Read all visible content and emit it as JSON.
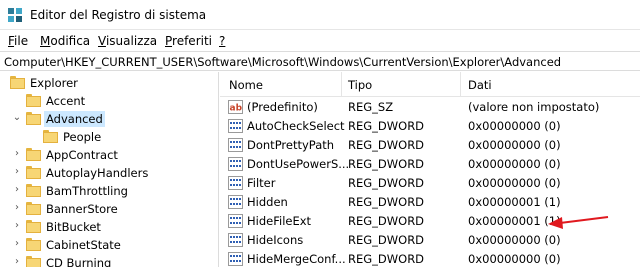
{
  "window": {
    "title": "Editor del Registro di sistema"
  },
  "menu": [
    {
      "label": "File",
      "accel": "F",
      "rest": "ile"
    },
    {
      "label": "Modifica",
      "accel": "M",
      "rest": "odifica"
    },
    {
      "label": "Visualizza",
      "accel": "V",
      "rest": "isualizza"
    },
    {
      "label": "Preferiti",
      "accel": "P",
      "rest": "referiti"
    },
    {
      "label": "?",
      "accel": "?",
      "rest": ""
    }
  ],
  "address": "Computer\\HKEY_CURRENT_USER\\Software\\Microsoft\\Windows\\CurrentVersion\\Explorer\\Advanced",
  "tree": [
    {
      "label": "Explorer",
      "expander": "",
      "level": 0,
      "selected": false
    },
    {
      "label": "Accent",
      "expander": "",
      "level": 1,
      "selected": false
    },
    {
      "label": "Advanced",
      "expander": "⌄",
      "level": 1,
      "selected": true
    },
    {
      "label": "People",
      "expander": "",
      "level": 2,
      "selected": false
    },
    {
      "label": "AppContract",
      "expander": "›",
      "level": 1,
      "selected": false
    },
    {
      "label": "AutoplayHandlers",
      "expander": "›",
      "level": 1,
      "selected": false
    },
    {
      "label": "BamThrottling",
      "expander": "›",
      "level": 1,
      "selected": false
    },
    {
      "label": "BannerStore",
      "expander": "›",
      "level": 1,
      "selected": false
    },
    {
      "label": "BitBucket",
      "expander": "›",
      "level": 1,
      "selected": false
    },
    {
      "label": "CabinetState",
      "expander": "›",
      "level": 1,
      "selected": false
    },
    {
      "label": "CD Burning",
      "expander": "›",
      "level": 1,
      "selected": false
    }
  ],
  "columns": {
    "name": "Nome",
    "type": "Tipo",
    "data": "Dati"
  },
  "values": [
    {
      "name": "(Predefinito)",
      "type": "REG_SZ",
      "data": "(valore non impostato)",
      "icon": "string-value-icon"
    },
    {
      "name": "AutoCheckSelect",
      "type": "REG_DWORD",
      "data": "0x00000000 (0)",
      "icon": "dword-value-icon"
    },
    {
      "name": "DontPrettyPath",
      "type": "REG_DWORD",
      "data": "0x00000000 (0)",
      "icon": "dword-value-icon"
    },
    {
      "name": "DontUsePowerS...",
      "type": "REG_DWORD",
      "data": "0x00000000 (0)",
      "icon": "dword-value-icon"
    },
    {
      "name": "Filter",
      "type": "REG_DWORD",
      "data": "0x00000000 (0)",
      "icon": "dword-value-icon"
    },
    {
      "name": "Hidden",
      "type": "REG_DWORD",
      "data": "0x00000001 (1)",
      "icon": "dword-value-icon"
    },
    {
      "name": "HideFileExt",
      "type": "REG_DWORD",
      "data": "0x00000001 (1)",
      "icon": "dword-value-icon"
    },
    {
      "name": "HideIcons",
      "type": "REG_DWORD",
      "data": "0x00000000 (0)",
      "icon": "dword-value-icon"
    },
    {
      "name": "HideMergeConf...",
      "type": "REG_DWORD",
      "data": "0x00000000 (0)",
      "icon": "dword-value-icon"
    }
  ],
  "colors": {
    "selection": "#cce8ff",
    "folder": "#f7d675",
    "arrow": "#e0191f",
    "dword_icon": "#2f5fb3",
    "string_icon": "#c8452b"
  }
}
